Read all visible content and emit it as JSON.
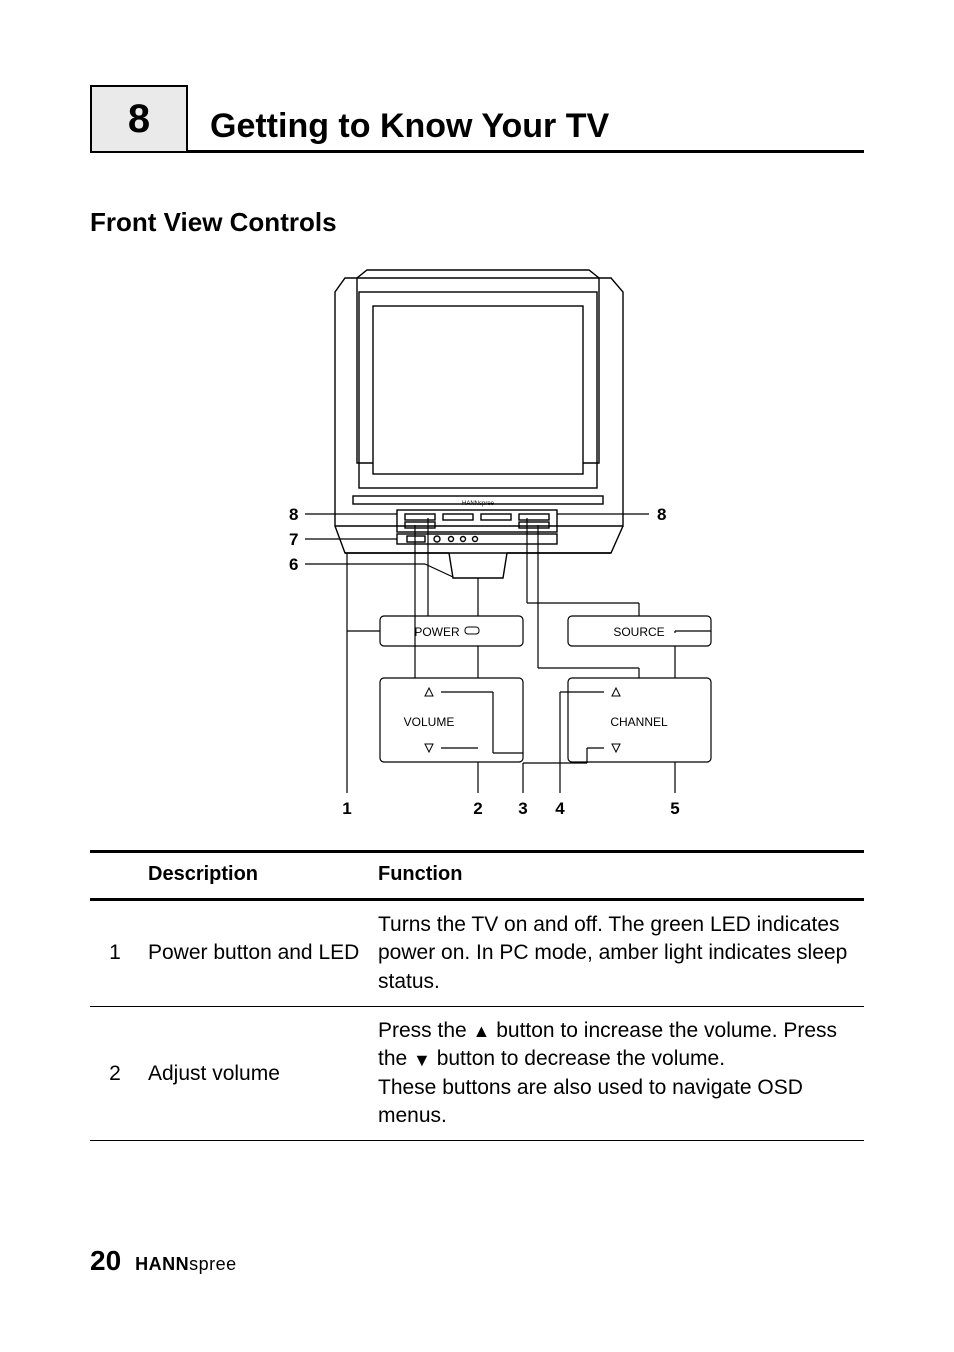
{
  "chapter": {
    "number": "8",
    "title": "Getting to Know Your TV"
  },
  "section": {
    "title": "Front View Controls"
  },
  "diagram": {
    "callouts": {
      "c1": "1",
      "c2": "2",
      "c3": "3",
      "c4": "4",
      "c5": "5",
      "c6": "6",
      "c7": "7",
      "c8l": "8",
      "c8r": "8"
    },
    "buttons": {
      "power": "POWER",
      "source": "SOURCE",
      "volume": "VOLUME",
      "channel": "CHANNEL"
    }
  },
  "table": {
    "headers": {
      "desc": "Description",
      "func": "Function"
    },
    "rows": [
      {
        "num": "1",
        "desc": "Power button and LED",
        "func": "Turns the TV on and off. The green LED indicates power on. In PC mode, amber light indicates sleep status."
      },
      {
        "num": "2",
        "desc": "Adjust volume",
        "func_pre": "Press the ",
        "func_mid1": " button to increase the volume. Press the ",
        "func_mid2": " button to decrease the volume.",
        "func_post": "These buttons are also used to navigate OSD menus."
      }
    ]
  },
  "footer": {
    "page": "20",
    "brand_bold": "HANN",
    "brand_light": "spree"
  }
}
